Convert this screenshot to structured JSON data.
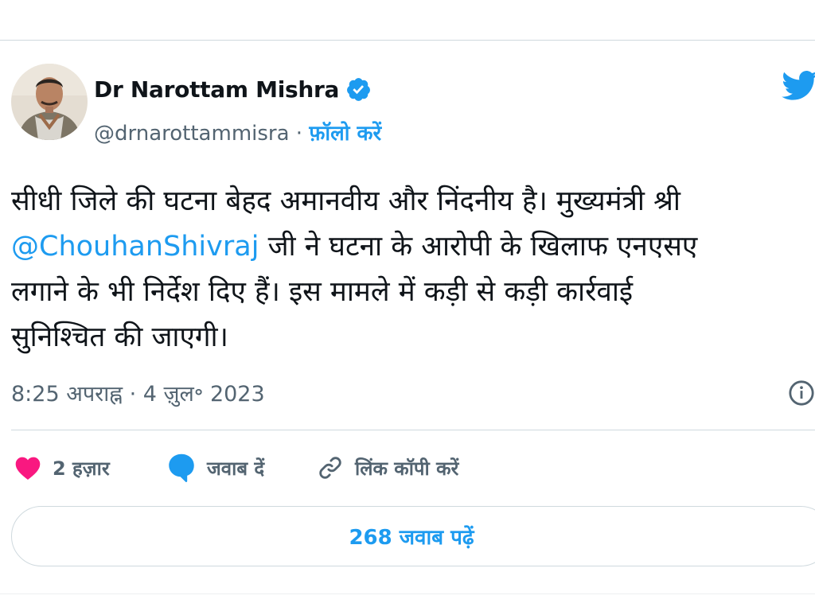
{
  "author": {
    "display_name": "Dr Narottam Mishra",
    "handle": "@drnarottammisra",
    "separator": " · ",
    "follow_label": "फ़ॉलो करें"
  },
  "tweet": {
    "lines": [
      "सीधी जिले की घटना बेहद अमानवीय और निंदनीय है। मुख्यमंत्री श्री",
      "जी ने घटना के आरोपी के खिलाफ एनएसए",
      "लगाने के भी निर्देश दिए हैं। इस मामले में कड़ी से कड़ी कार्रवाई",
      "सुनिश्चित की जाएगी।"
    ],
    "mention": "@ChouhanShivraj",
    "timestamp": "8:25 अपराह्न · 4 ज़ुल॰ 2023"
  },
  "actions": {
    "likes": "2 हज़ार",
    "reply": "जवाब दें",
    "copy_link": "लिंक कॉपी करें"
  },
  "read_replies": "268 जवाब पढ़ें",
  "colors": {
    "accent": "#1d9bf0",
    "like": "#f91880",
    "muted_text": "#536471",
    "border": "#cfd9de"
  },
  "icons": [
    "verified-badge-icon",
    "twitter-bird-icon",
    "info-icon",
    "heart-icon",
    "reply-bubble-icon",
    "link-icon"
  ]
}
